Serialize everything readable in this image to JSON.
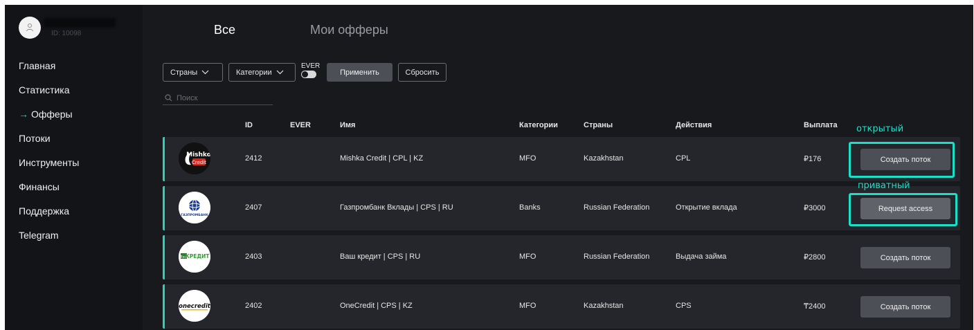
{
  "user": {
    "id_label": "ID: 10098"
  },
  "sidebar": {
    "items": [
      {
        "label": "Главная"
      },
      {
        "label": "Статистика"
      },
      {
        "label": "Офферы",
        "active": true
      },
      {
        "label": "Потоки"
      },
      {
        "label": "Инструменты"
      },
      {
        "label": "Финансы"
      },
      {
        "label": "Поддержка"
      },
      {
        "label": "Telegram"
      }
    ],
    "active_marker": "→"
  },
  "tabs": {
    "all": "Все",
    "my": "Мои офферы"
  },
  "filters": {
    "countries": "Страны",
    "categories": "Категории",
    "ever": "EVER",
    "apply": "Применить",
    "reset": "Сбросить"
  },
  "search": {
    "placeholder": "Поиск"
  },
  "table": {
    "headers": {
      "id": "ID",
      "ever": "EVER",
      "name": "Имя",
      "categories": "Категории",
      "countries": "Страны",
      "actions": "Действия",
      "payout": "Выплата"
    },
    "rows": [
      {
        "id": "2412",
        "name": "Mishka Credit | CPL | KZ",
        "category": "MFO",
        "country": "Kazakhstan",
        "action": "CPL",
        "payout": "₽176",
        "button": "Создать поток",
        "logo_text": "Mishka Credit"
      },
      {
        "id": "2407",
        "name": "Газпромбанк Вклады | CPS | RU",
        "category": "Banks",
        "country": "Russian Federation",
        "action": "Открытие вклада",
        "payout": "₽3000",
        "button": "Request access",
        "logo_text": "ГАЗПРОМБАНК"
      },
      {
        "id": "2403",
        "name": "Ваш кредит | CPS | RU",
        "category": "MFO",
        "country": "Russian Federation",
        "action": "Выдача займа",
        "payout": "₽2800",
        "button": "Создать поток",
        "logo_text": "Ваш КРЕДИТ"
      },
      {
        "id": "2402",
        "name": "OneCredit | CPS | KZ",
        "category": "MFO",
        "country": "Kazakhstan",
        "action": "CPS",
        "payout": "₸2400",
        "button": "Создать поток",
        "logo_text": "onecredit"
      }
    ]
  },
  "annotations": {
    "open": "открытый",
    "private": "приватный",
    "color": "#18e0c9"
  },
  "colors": {
    "accent": "#2fd0b5",
    "background": "#18191d",
    "sidebar": "#131417",
    "row": "#25262b",
    "button": "#4d4f56"
  }
}
